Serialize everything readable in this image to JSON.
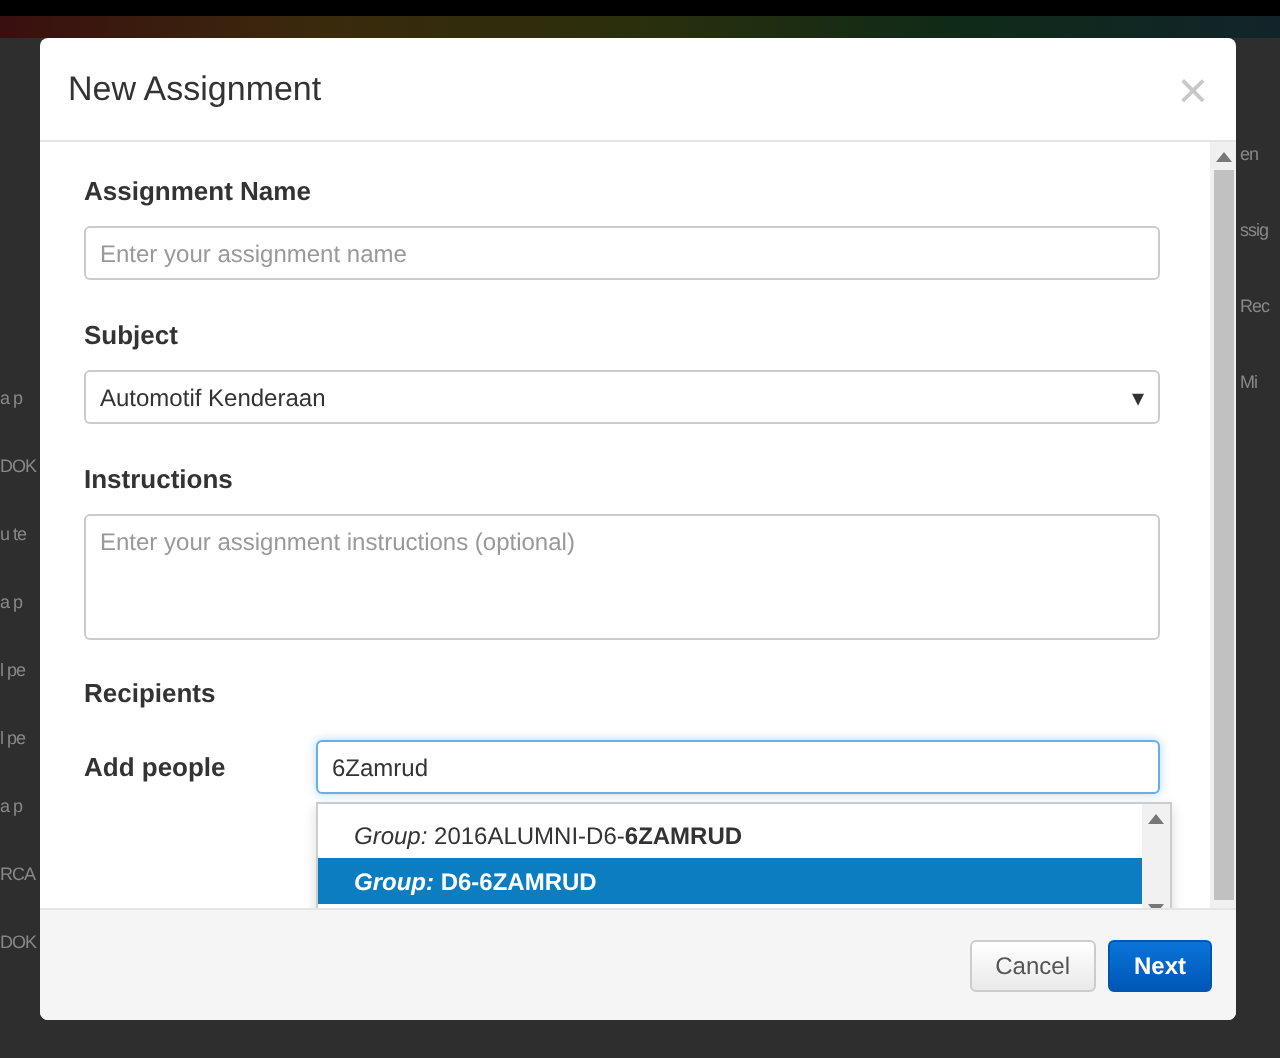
{
  "background": {
    "left_fragments": [
      "a p",
      "DOK",
      "u te",
      "a p",
      "l pe",
      "l pe",
      "a p",
      "RCA",
      "DOK"
    ],
    "right_fragments": [
      "en",
      "ssig",
      "Rec",
      "Mi"
    ]
  },
  "modal": {
    "title": "New Assignment",
    "close": "×",
    "fields": [
      {
        "kind": "text",
        "label": "Assignment Name",
        "placeholder": "Enter your assignment name"
      },
      {
        "kind": "select",
        "label": "Subject",
        "value": "Automotif Kenderaan",
        "caret": "▾"
      },
      {
        "kind": "textarea",
        "label": "Instructions",
        "placeholder": "Enter your assignment instructions (optional)"
      }
    ],
    "recipients": {
      "heading": "Recipients",
      "label": "Add people",
      "value": "6Zamrud",
      "suggestions": [
        {
          "text": "*Group:* 2016ALUMNI-D6-**6ZAMRUD**",
          "selected": false
        },
        {
          "text": "*Group:* D6-**6ZAMRUD**",
          "selected": true
        }
      ]
    },
    "buttons": [
      {
        "label": "Cancel",
        "kind": "secondary"
      },
      {
        "label": "Next",
        "kind": "primary"
      }
    ]
  }
}
